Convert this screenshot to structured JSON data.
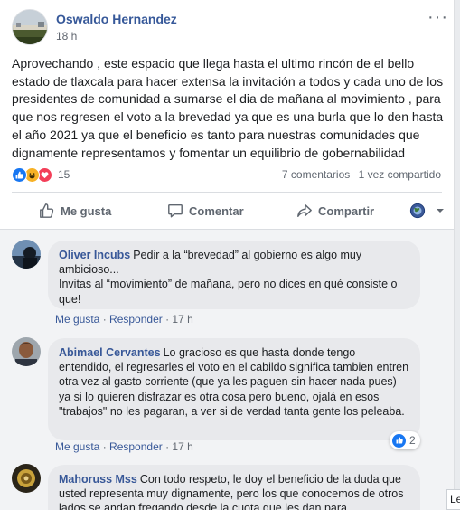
{
  "post": {
    "author": "Oswaldo Hernandez",
    "time": "18 h",
    "more_label": "···",
    "text": "Aprovechando , este espacio que llega hasta el ultimo rincón de el bello estado de tlaxcala para hacer extensa la invitación a todos y cada uno de los presidentes de comunidad a sumarse el dia de mañana al movimiento , para que nos regresen el voto a la brevedad ya que es una burla que lo den hasta el año 2021 ya que el beneficio es tanto para nuestras comunidades que dignamente representamos y fomentar un equilibrio de gobernabilidad",
    "reaction_count": "15",
    "comments_count": "7 comentarios",
    "shares_count": "1 vez compartido"
  },
  "actions": {
    "like": "Me gusta",
    "comment": "Comentar",
    "share": "Compartir"
  },
  "comments": [
    {
      "author": "Oliver Incubs",
      "text": "Pedir a la “brevedad” al gobierno es algo muy ambicioso...\nInvitas al “movimiento” de mañana, pero no dices en qué consiste o que!",
      "like": "Me gusta",
      "reply": "Responder",
      "time": "17 h"
    },
    {
      "author": "Abimael Cervantes",
      "text": "Lo gracioso es que hasta donde tengo entendido, el regresarles el voto en el cabildo significa tambien entren otra vez al gasto corriente (que ya les paguen sin hacer nada pues) ya si lo quieren disfrazar es otra cosa pero bueno, ojalá en esos \"trabajos\" no les pagaran, a ver si de verdad tanta gente los peleaba.",
      "like": "Me gusta",
      "reply": "Responder",
      "time": "17 h",
      "reaction_count": "2"
    },
    {
      "author": "Mahoruss Mss",
      "text": "Con todo respeto, le doy el beneficio de la duda que usted representa muy dignamente, pero los que conocemos de otros lados se andan fregando desde la cuota que les dan para"
    }
  ],
  "sidebar_tag": "Le",
  "colors": {
    "link": "#385898",
    "like_blue": "#1877f2",
    "haha_yellow": "#f7b125",
    "love_red": "#f33e58",
    "bubble_bg": "#e8e9ec"
  },
  "icons": [
    "like-icon",
    "haha-icon",
    "love-icon",
    "thumbs-up-icon",
    "comment-icon",
    "share-icon",
    "globe-icon",
    "chevron-down-icon",
    "more-icon"
  ]
}
